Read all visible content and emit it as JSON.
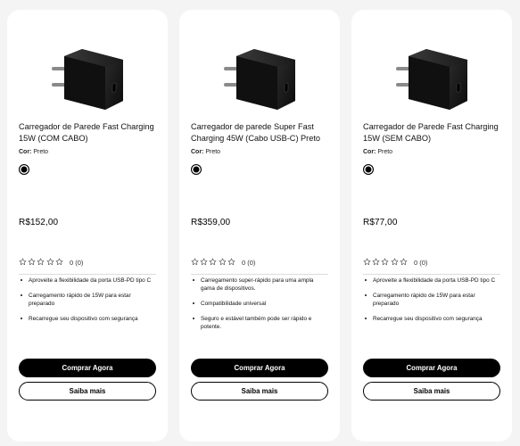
{
  "products": [
    {
      "title": "Carregador de Parede Fast Charging 15W (COM CABO)",
      "color_label": "Cor:",
      "color_value": "Preto",
      "swatch_color": "#000000",
      "price": "R$152,00",
      "rating_count": "0 (0)",
      "features": [
        "Aproveite a flexibilidade da porta USB-PD tipo C",
        "Carregamento rápido de 15W para estar preparado",
        "Recarregue seu dispositivo com segurança"
      ],
      "buy_label": "Comprar Agora",
      "learn_label": "Saiba mais",
      "image_icon": "wall-charger-image"
    },
    {
      "title": "Carregador de parede Super Fast Charging 45W (Cabo USB-C) Preto",
      "color_label": "Cor:",
      "color_value": "Preto",
      "swatch_color": "#000000",
      "price": "R$359,00",
      "rating_count": "0 (0)",
      "features": [
        "Carregamento super-rápido para uma ampla gama de dispositivos.",
        "Compatibilidade universal",
        "Seguro e estável também pode ser rápido e potente."
      ],
      "buy_label": "Comprar Agora",
      "learn_label": "Saiba mais",
      "image_icon": "wall-charger-image"
    },
    {
      "title": "Carregador de Parede Fast Charging 15W (SEM CABO)",
      "color_label": "Cor:",
      "color_value": "Preto",
      "swatch_color": "#000000",
      "price": "R$77,00",
      "rating_count": "0 (0)",
      "features": [
        "Aproveite a flexibilidade da porta USB-PD tipo C",
        "Carregamento rápido de 15W para estar preparado",
        "Recarregue seu dispositivo com segurança"
      ],
      "buy_label": "Comprar Agora",
      "learn_label": "Saiba mais",
      "image_icon": "wall-charger-image"
    }
  ],
  "rating_stars": 5,
  "rating_value": 0,
  "colors": {
    "button_primary": "#000000",
    "button_primary_text": "#ffffff",
    "page_background": "#f4f4f4",
    "card_background": "#ffffff"
  }
}
